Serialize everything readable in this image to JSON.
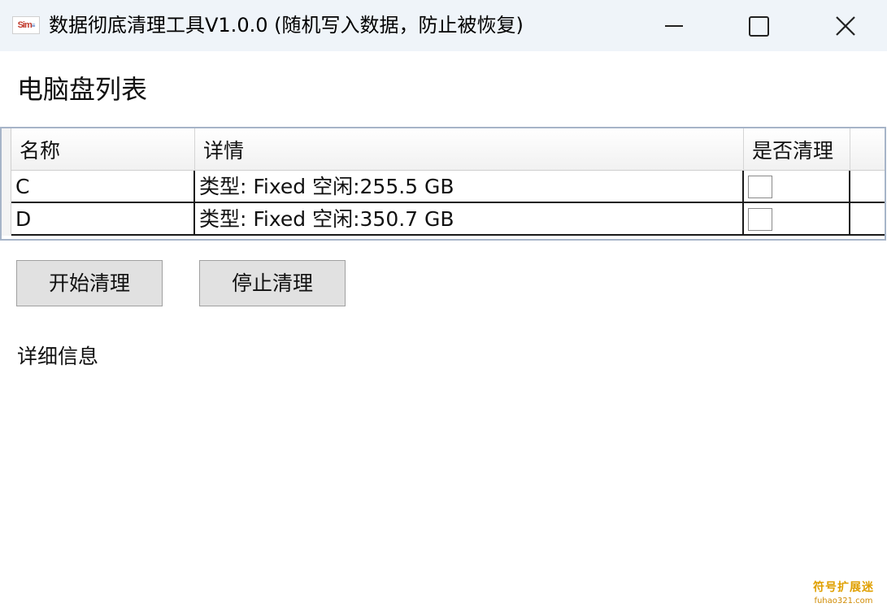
{
  "window": {
    "title": "数据彻底清理工具V1.0.0 (随机写入数据，防止被恢复)",
    "icon_text": "Sim"
  },
  "main": {
    "section_title": "电脑盘列表",
    "grid": {
      "columns": [
        "名称",
        "详情",
        "是否清理",
        ""
      ],
      "rows": [
        {
          "name": "C",
          "detail": "类型: Fixed 空闲:255.5 GB",
          "clean": false
        },
        {
          "name": "D",
          "detail": "类型: Fixed 空闲:350.7 GB",
          "clean": false
        }
      ]
    },
    "buttons": {
      "start": "开始清理",
      "stop": "停止清理"
    },
    "detail_label": "详细信息"
  },
  "watermark": {
    "top": "符号扩展迷",
    "bottom": "fuhao321.com"
  },
  "colors": {
    "titlebar_bg": "#eff4f9",
    "button_bg": "#e1e1e1",
    "grid_border": "#a6b4c8"
  }
}
